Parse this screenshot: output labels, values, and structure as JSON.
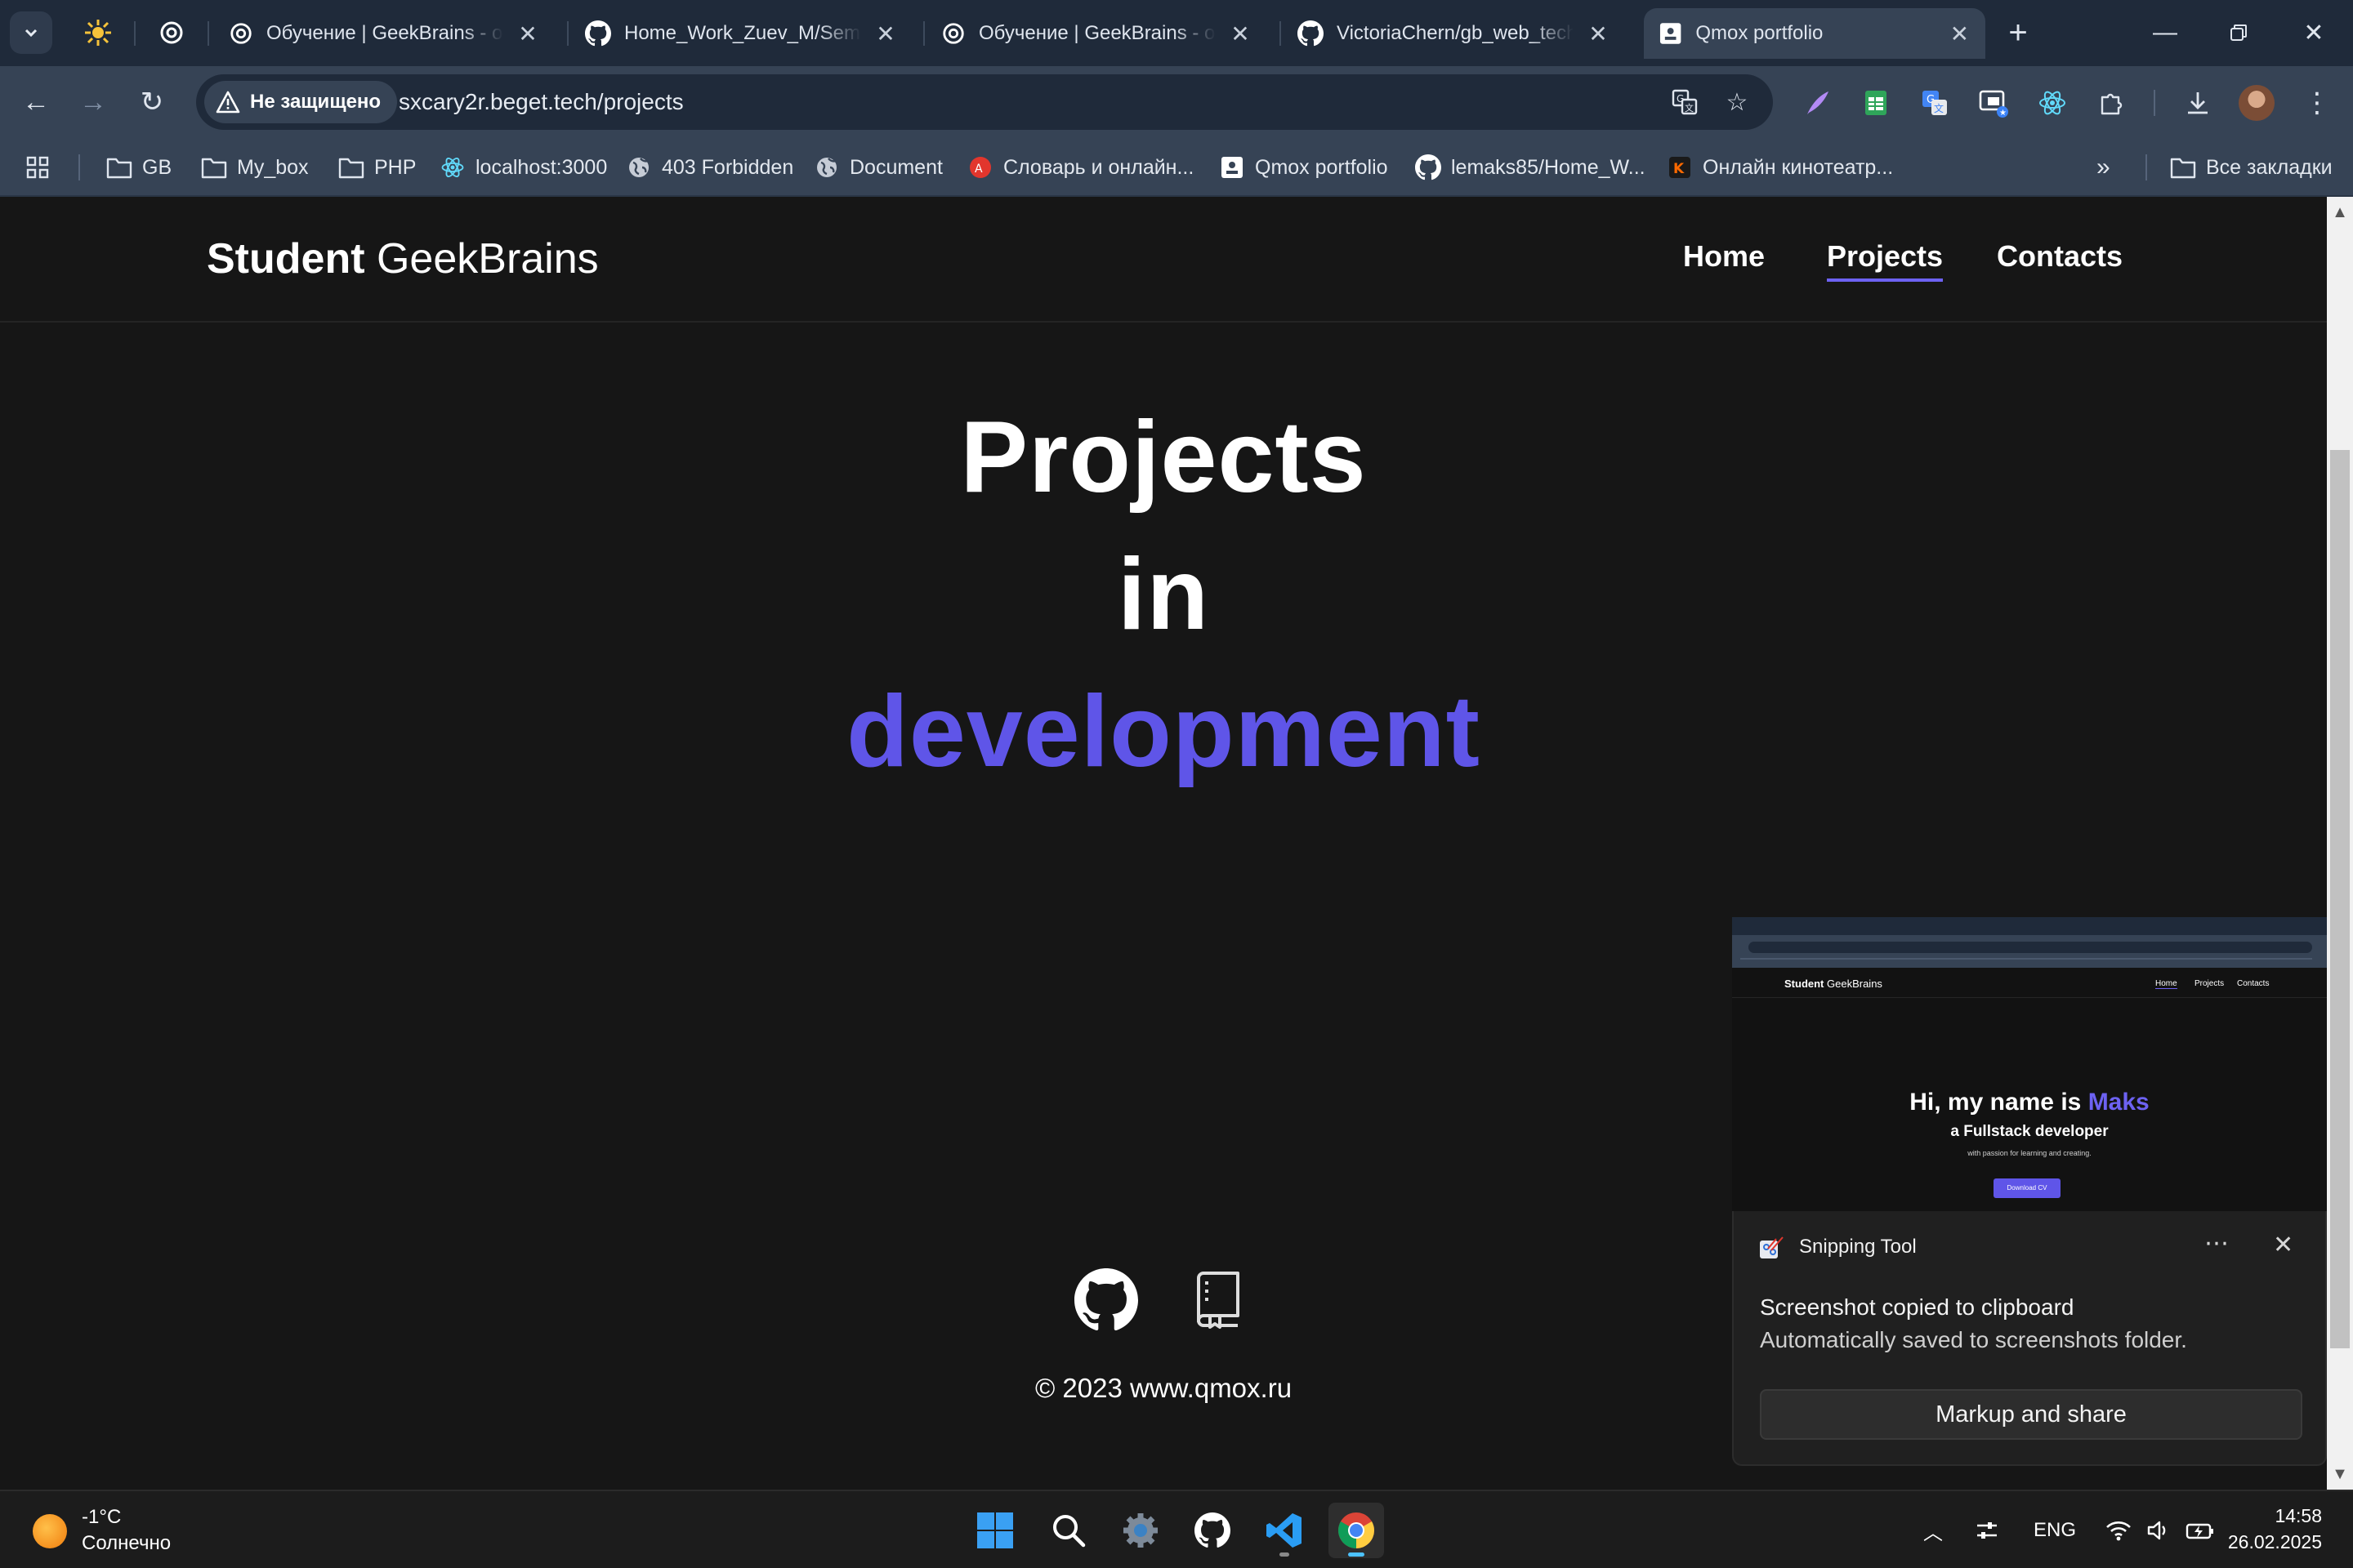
{
  "browser": {
    "tabs": [
      {
        "title": "Обучение | GeekBrains - об",
        "icon": "openai-icon"
      },
      {
        "title": "Home_Work_Zuev_M/Semin",
        "icon": "github-icon"
      },
      {
        "title": "Обучение | GeekBrains - об",
        "icon": "openai-icon"
      },
      {
        "title": "VictoriaChern/gb_web_tech",
        "icon": "github-icon"
      },
      {
        "title": "Qmox portfolio",
        "icon": "page-icon",
        "active": true
      }
    ],
    "security_label": "Не защищено",
    "url": "sxcary2r.beget.tech/projects",
    "bookmarks": [
      {
        "label": "GB",
        "icon": "folder-icon"
      },
      {
        "label": "My_box",
        "icon": "folder-icon"
      },
      {
        "label": "PHP",
        "icon": "folder-icon"
      },
      {
        "label": "localhost:3000",
        "icon": "react-icon"
      },
      {
        "label": "403 Forbidden",
        "icon": "globe-icon"
      },
      {
        "label": "Document",
        "icon": "globe-icon"
      },
      {
        "label": "Словарь и онлайн...",
        "icon": "dictionary-icon"
      },
      {
        "label": "Qmox portfolio",
        "icon": "page-icon"
      },
      {
        "label": "lemaks85/Home_W...",
        "icon": "github-icon"
      },
      {
        "label": "Онлайн кинотеатр...",
        "icon": "cinema-icon"
      }
    ],
    "all_bookmarks_label": "Все закладки"
  },
  "site": {
    "brand_bold": "Student",
    "brand_rest": " GeekBrains",
    "nav": {
      "home": "Home",
      "projects": "Projects",
      "contacts": "Contacts"
    },
    "hero": {
      "line1": "Projects",
      "line2": "in",
      "line3": "development"
    },
    "copyright": "© 2023 www.qmox.ru",
    "accent_color": "#5f55e8"
  },
  "snip_preview": {
    "brand_bold": "Student",
    "brand_rest": " GeekBrains",
    "nav": {
      "home": "Home",
      "projects": "Projects",
      "contacts": "Contacts"
    },
    "hi_prefix": "Hi, my name is ",
    "hi_name": "Maks",
    "role": "a Fullstack developer",
    "passion": "with passion for learning and creating.",
    "button": "Download CV"
  },
  "notification": {
    "app": "Snipping Tool",
    "title": "Screenshot copied to clipboard",
    "body": "Automatically saved to screenshots folder.",
    "action": "Markup and share"
  },
  "taskbar": {
    "temp": "-1°C",
    "weather": "Солнечно",
    "lang": "ENG",
    "time": "14:58",
    "date": "26.02.2025"
  }
}
